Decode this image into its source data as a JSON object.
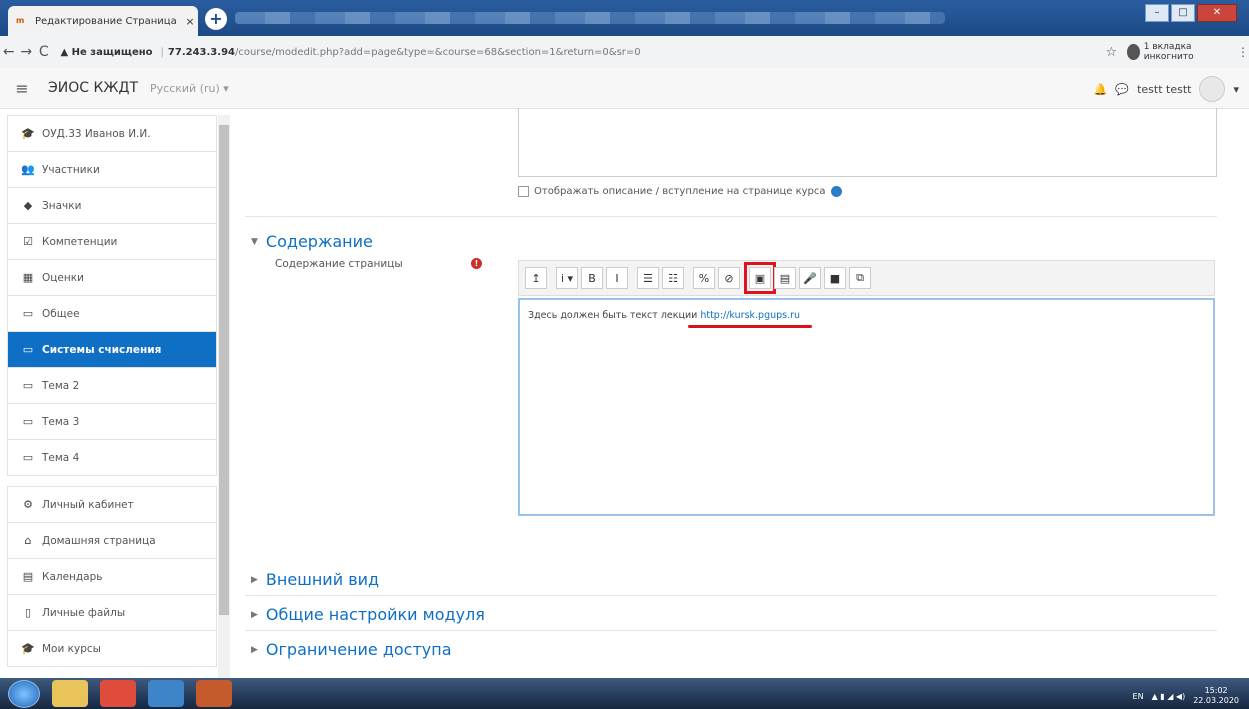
{
  "browser": {
    "tab_title": "Редактирование Страница",
    "tab_close": "×",
    "new_tab": "+",
    "url_warning": "▲ Не защищено",
    "url_host": "77.243.3.94",
    "url_path": "/course/modedit.php?add=page&type=&course=68&section=1&return=0&sr=0",
    "incognito_label": "1 вкладка инкогнито"
  },
  "navbar": {
    "brand": "ЭИОС КЖДТ",
    "language": "Русский (ru) ▾",
    "user_name": "testt testt"
  },
  "sidebar": {
    "items": [
      {
        "label": "ОУД.33 Иванов И.И.",
        "icon": "graduation-cap-icon",
        "glyph": "🎓"
      },
      {
        "label": "Участники",
        "icon": "users-icon",
        "glyph": "👥"
      },
      {
        "label": "Значки",
        "icon": "badge-icon",
        "glyph": "◆"
      },
      {
        "label": "Компетенции",
        "icon": "checkbox-icon",
        "glyph": "☑"
      },
      {
        "label": "Оценки",
        "icon": "table-icon",
        "glyph": "▦"
      },
      {
        "label": "Общее",
        "icon": "folder-icon",
        "glyph": "▭"
      },
      {
        "label": "Системы счисления",
        "icon": "folder-icon",
        "glyph": "▭",
        "active": true
      },
      {
        "label": "Тема 2",
        "icon": "folder-icon",
        "glyph": "▭"
      },
      {
        "label": "Тема 3",
        "icon": "folder-icon",
        "glyph": "▭"
      },
      {
        "label": "Тема 4",
        "icon": "folder-icon",
        "glyph": "▭"
      }
    ],
    "items2": [
      {
        "label": "Личный кабинет",
        "icon": "dashboard-icon",
        "glyph": "⚙"
      },
      {
        "label": "Домашняя страница",
        "icon": "home-icon",
        "glyph": "⌂"
      },
      {
        "label": "Календарь",
        "icon": "calendar-icon",
        "glyph": "▤"
      },
      {
        "label": "Личные файлы",
        "icon": "file-icon",
        "glyph": "▯"
      },
      {
        "label": "Мои курсы",
        "icon": "graduation-cap-icon",
        "glyph": "🎓"
      }
    ]
  },
  "form": {
    "show_description_label": "Отображать описание / вступление на странице курса",
    "section_content": "Содержание",
    "page_content_label": "Содержание страницы",
    "editor_text": "Здесь должен быть текст лекции ",
    "editor_link": "http://kursk.pgups.ru",
    "section_appearance": "Внешний вид",
    "section_module_settings": "Общие настройки модуля",
    "section_access": "Ограничение доступа"
  },
  "toolbar": {
    "buttons": [
      "↥",
      "i ▾",
      "B",
      "I",
      "☰",
      "☷",
      "%",
      "⊘",
      "▣",
      "▤",
      "🎤",
      "■",
      "⧉"
    ]
  },
  "taskbar": {
    "lang": "EN",
    "time": "15:02",
    "date": "22.03.2020"
  },
  "colors": {
    "accent": "#0f6fc5",
    "highlight": "#e0121e"
  }
}
